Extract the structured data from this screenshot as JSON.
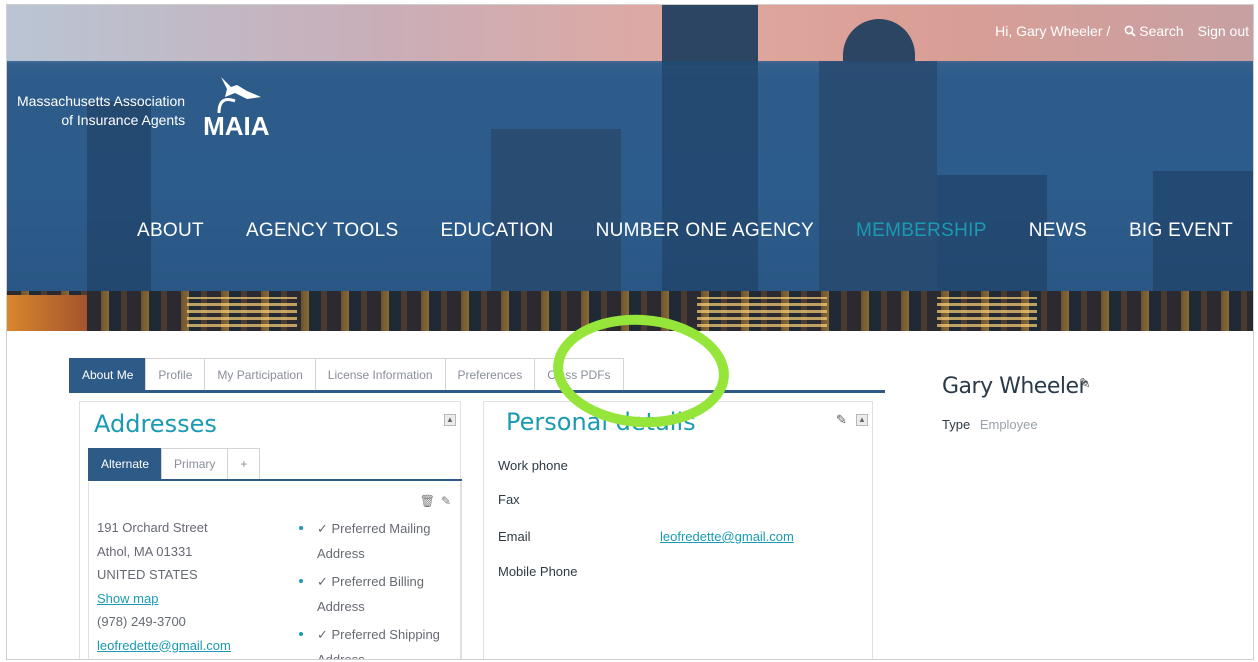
{
  "header": {
    "greeting": "Hi, Gary Wheeler /",
    "search_label": "Search",
    "signout_label": "Sign out",
    "org_name_line1": "Massachusetts Association",
    "org_name_line2": "of Insurance Agents",
    "logo_word": "MAIA"
  },
  "nav": {
    "items": [
      "ABOUT",
      "AGENCY TOOLS",
      "EDUCATION",
      "NUMBER ONE AGENCY",
      "MEMBERSHIP",
      "NEWS",
      "BIG EVENT"
    ],
    "active": "MEMBERSHIP",
    "active_color": "#1a9bb3"
  },
  "tabs": {
    "items": [
      "About Me",
      "Profile",
      "My Participation",
      "License Information",
      "Preferences",
      "Class PDFs"
    ],
    "active": "About Me"
  },
  "addresses": {
    "title": "Addresses",
    "sub_tabs": [
      "Alternate",
      "Primary",
      "+"
    ],
    "active_sub_tab": "Alternate",
    "street": "191 Orchard Street",
    "city_line": "Athol, MA 01331",
    "country": "UNITED STATES",
    "map_link": "Show map",
    "phone": "(978) 249-3700",
    "email": "leofredette@gmail.com",
    "preferences": [
      "✓ Preferred Mailing Address",
      "✓ Preferred Billing Address",
      "✓ Preferred Shipping Address"
    ]
  },
  "personal_details": {
    "title": "Personal details",
    "work_phone_label": "Work phone",
    "fax_label": "Fax",
    "email_label": "Email",
    "email_value": "leofredette@gmail.com",
    "mobile_label": "Mobile Phone"
  },
  "profile": {
    "name": "Gary Wheeler",
    "type_label": "Type",
    "type_value": "Employee"
  },
  "colors": {
    "brand_blue": "#2d5a87",
    "accent_teal": "#1a9bb3",
    "highlight_green": "#96e53b"
  }
}
